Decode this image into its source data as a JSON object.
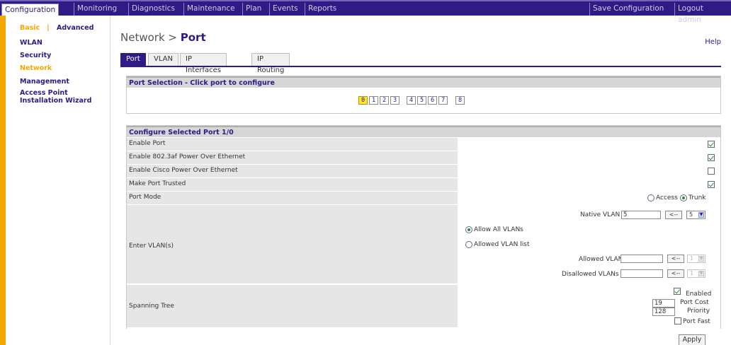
{
  "topnav": {
    "items": [
      "Configuration",
      "Monitoring",
      "Diagnostics",
      "Maintenance",
      "Plan",
      "Events",
      "Reports"
    ],
    "save": "Save Configuration",
    "logout": "Logout admin"
  },
  "sidebar": {
    "basic": "Basic",
    "separator": "|",
    "advanced": "Advanced",
    "items": [
      "WLAN",
      "Security",
      "Network",
      "Management",
      "Access Point",
      "Installation Wizard"
    ]
  },
  "page": {
    "title_prefix": "Network >",
    "title_main": "Port",
    "help": "Help"
  },
  "tabs": [
    "Port",
    "VLAN",
    "IP Interfaces",
    "IP Routing"
  ],
  "port_selection": {
    "header": "Port Selection - Click port to configure",
    "ports": [
      "0",
      "1",
      "2",
      "3",
      "4",
      "5",
      "6",
      "7",
      "8"
    ]
  },
  "configure": {
    "header": "Configure Selected Port 1/0",
    "enable_port": "Enable Port",
    "enable_poe": "Enable 802.3af Power Over Ethernet",
    "enable_cisco_poe": "Enable Cisco Power Over Ethernet",
    "make_trusted": "Make Port Trusted",
    "port_mode": "Port Mode",
    "mode_access": "Access",
    "mode_trunk": "Trunk",
    "native_vlan_label": "Native VLAN",
    "native_vlan_value": "5",
    "native_vlan_select": "5",
    "arrow_button": "<--",
    "enter_vlans": "Enter VLAN(s)",
    "allow_all": "Allow All VLANs",
    "allowed_list": "Allowed VLAN list",
    "allowed_vlans": "Allowed VLANs",
    "disallowed_vlans": "Disallowed VLANs",
    "disabled_select": "1",
    "spanning_tree": "Spanning Tree",
    "enabled": "Enabled",
    "port_cost_value": "19",
    "port_cost": "Port Cost",
    "priority_value": "128",
    "priority": "Priority",
    "port_fast": "Port Fast"
  },
  "apply": "Apply"
}
